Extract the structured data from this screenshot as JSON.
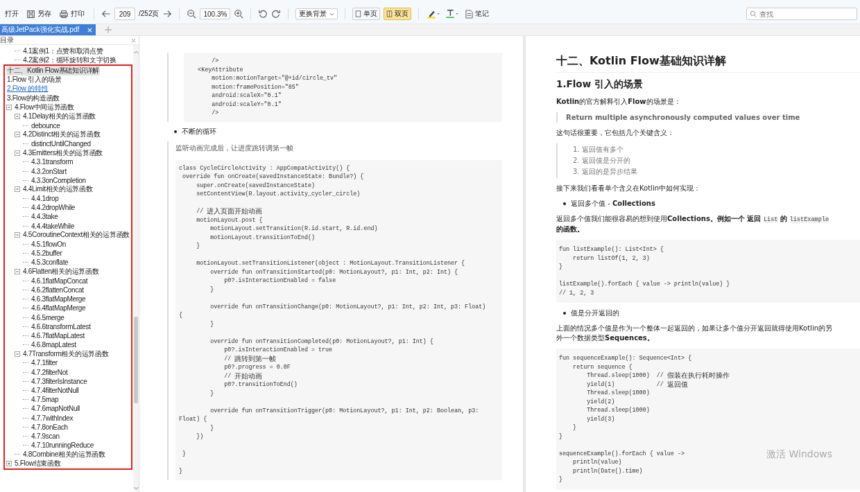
{
  "toolbar": {
    "items": [
      {
        "kind": "open",
        "label": "打开"
      },
      {
        "kind": "save",
        "label": "另存"
      },
      {
        "kind": "print",
        "label": "打印"
      },
      {
        "kind": "sep"
      },
      {
        "kind": "prev"
      },
      {
        "kind": "page",
        "value": "209",
        "total": "/252页"
      },
      {
        "kind": "next"
      },
      {
        "kind": "sep"
      },
      {
        "kind": "zoom_out"
      },
      {
        "kind": "zoom",
        "value": "100.3%"
      },
      {
        "kind": "zoom_in"
      },
      {
        "kind": "sep"
      },
      {
        "kind": "rotate_left"
      },
      {
        "kind": "rotate_right"
      },
      {
        "kind": "sep"
      },
      {
        "kind": "background",
        "label": "更换背景"
      },
      {
        "kind": "sep"
      },
      {
        "kind": "view",
        "label": "单页",
        "selected": false
      },
      {
        "kind": "view",
        "label": "双页",
        "selected": true
      },
      {
        "kind": "sep"
      },
      {
        "kind": "highlight"
      },
      {
        "kind": "text_color"
      },
      {
        "kind": "note",
        "label": "笔记"
      }
    ],
    "search": {
      "placeholder": "查找"
    }
  },
  "tabs": [
    {
      "label": "高级JetPack强化实战.pdf",
      "selected": true
    }
  ],
  "sidebar": {
    "title": "目录",
    "toc_above": [
      {
        "label": "4.1案例1：点赞和取消点赞",
        "selected": false,
        "hovered": false
      },
      {
        "label": "4.2案例2：循环旋转和文字切换",
        "selected": false,
        "hovered": false
      }
    ],
    "toc": [
      {
        "label": "十二、Kotlin Flow基础知识详解",
        "selected": true,
        "hovered": false
      },
      {
        "label": "1.Flow 引入的场景",
        "selected": false,
        "hovered": false
      },
      {
        "label": "2.Flow 的特性",
        "selected": false,
        "hovered": true
      },
      {
        "label": "3.Flow的构造函数",
        "selected": false,
        "hovered": false
      },
      {
        "label": "4.Flow中间运算函数",
        "selected": false,
        "hovered": false,
        "expanded": true,
        "children": [
          {
            "label": "4.1Delay相关的运算函数",
            "selected": false,
            "hovered": false,
            "expanded": true,
            "children": [
              {
                "label": "debounce",
                "selected": false,
                "hovered": false
              }
            ]
          },
          {
            "label": "4.2Distinct相关的运算函数",
            "selected": false,
            "hovered": false,
            "expanded": true,
            "children": [
              {
                "label": "distinctUntilChanged",
                "selected": false,
                "hovered": false
              }
            ]
          },
          {
            "label": "4.3Emitters相关的运算函数",
            "selected": false,
            "hovered": false,
            "expanded": true,
            "children": [
              {
                "label": "4.3.1transform",
                "selected": false,
                "hovered": false
              },
              {
                "label": "4.3.2onStart",
                "selected": false,
                "hovered": false
              },
              {
                "label": "4.3.3onCompletion",
                "selected": false,
                "hovered": false
              }
            ]
          },
          {
            "label": "4.4Limit相关的运算函数",
            "selected": false,
            "hovered": false,
            "expanded": true,
            "children": [
              {
                "label": "4.4.1drop",
                "selected": false,
                "hovered": false
              },
              {
                "label": "4.4.2dropWhile",
                "selected": false,
                "hovered": false
              },
              {
                "label": "4.4.3take",
                "selected": false,
                "hovered": false
              },
              {
                "label": "4.4.4takeWhile",
                "selected": false,
                "hovered": false
              }
            ]
          },
          {
            "label": "4.5CoroutineContext相关的运算函数",
            "selected": false,
            "hovered": false,
            "expanded": true,
            "children": [
              {
                "label": "4.5.1flowOn",
                "selected": false,
                "hovered": false
              },
              {
                "label": "4.5.2buffer",
                "selected": false,
                "hovered": false
              },
              {
                "label": "4.5.3conflate",
                "selected": false,
                "hovered": false
              }
            ]
          },
          {
            "label": "4.6Flatten相关的运算函数",
            "selected": false,
            "hovered": false,
            "expanded": true,
            "children": [
              {
                "label": "4.6.1flatMapConcat",
                "selected": false,
                "hovered": false
              },
              {
                "label": "4.6.2flattenConcat",
                "selected": false,
                "hovered": false
              },
              {
                "label": "4.6.3flatMapMerge",
                "selected": false,
                "hovered": false
              },
              {
                "label": "4.6.4flatMapMerge",
                "selected": false,
                "hovered": false
              },
              {
                "label": "4.6.5merge",
                "selected": false,
                "hovered": false
              },
              {
                "label": "4.6.6transformLatest",
                "selected": false,
                "hovered": false
              },
              {
                "label": "4.6.7flatMapLatest",
                "selected": false,
                "hovered": false
              },
              {
                "label": "4.6.8mapLatest",
                "selected": false,
                "hovered": false
              }
            ]
          },
          {
            "label": "4.7Transform相关的运算函数",
            "selected": false,
            "hovered": false,
            "expanded": true,
            "children": [
              {
                "label": "4.7.1filter",
                "selected": false,
                "hovered": false
              },
              {
                "label": "4.7.2filterNot",
                "selected": false,
                "hovered": false
              },
              {
                "label": "4.7.3filterIsInstance",
                "selected": false,
                "hovered": false
              },
              {
                "label": "4.7.4filterNotNull",
                "selected": false,
                "hovered": false
              },
              {
                "label": "4.7.5map",
                "selected": false,
                "hovered": false
              },
              {
                "label": "4.7.6mapNotNull",
                "selected": false,
                "hovered": false
              },
              {
                "label": "4.7.7withIndex",
                "selected": false,
                "hovered": false
              },
              {
                "label": "4.7.8onEach",
                "selected": false,
                "hovered": false
              },
              {
                "label": "4.7.9scan",
                "selected": false,
                "hovered": false
              },
              {
                "label": "4.7.10runningReduce",
                "selected": false,
                "hovered": false
              }
            ]
          },
          {
            "label": "4.8Combine相关的运算函数",
            "selected": false,
            "hovered": false
          }
        ]
      },
      {
        "label": "5.Flow结束函数",
        "selected": false,
        "hovered": false,
        "expanded": false
      }
    ]
  },
  "pages": [
    {
      "blocks": [
        {
          "kind": "code",
          "code": "        />\n    <KeyAttribute\n        motion:motionTarget=\"@+id/circle_tv\"\n        motion:framePosition=\"85\"\n        android:scaleX=\"0.1\"\n        android:scaleY=\"0.1\"\n        />"
        },
        {
          "kind": "bullet",
          "text": "不断的循环"
        },
        {
          "kind": "quote",
          "text": "监听动画完成后，让进度跳转调第一帧"
        },
        {
          "kind": "code",
          "code": "class CycleCircleActivity : AppCompatActivity() {\n override fun onCreate(savedInstanceState: Bundle?) {\n     super.onCreate(savedInstanceState)\n     setContentView(R.layout.activity_cycler_circle)\n\n     // 进入页面开始动画\n     motionLayout.post {\n         motionLayout.setTransition(R.id.start, R.id.end)\n         motionLayout.transitionToEnd()\n     }\n\n     motionLayout.setTransitionListener(object : MotionLayout.TransitionListener {\n         override fun onTransitionStarted(p0: MotionLayout?, p1: Int, p2: Int) {\n             p0?.isInteractionEnabled = false\n         }\n\n         override fun onTransitionChange(p0: MotionLayout?, p1: Int, p2: Int, p3: Float)\n{\n         }\n\n         override fun onTransitionCompleted(p0: MotionLayout?, p1: Int) {\n             p0?.isInteractionEnabled = true\n             // 跳转到第一帧\n             p0?.progress = 0.0F\n             // 开始动画\n             p0?.transitionToEnd()\n         }\n\n         override fun onTransitionTrigger(p0: MotionLayout?, p1: Int, p2: Boolean, p3:\nFloat) {\n         }\n     })\n\n }\n\n}"
        }
      ]
    },
    {
      "blocks": [
        {
          "kind": "h1",
          "text": "十二、Kotlin Flow基础知识详解"
        },
        {
          "kind": "h2",
          "text": "1.Flow 引入的场景"
        },
        {
          "kind": "p",
          "runs": [
            {
              "kind": "text",
              "text": "**Kotlin**的官方解释引入**Flow**的场景是："
            }
          ]
        },
        {
          "kind": "quote_strong",
          "text": "Return multiple asynchronously computed values over time"
        },
        {
          "kind": "p",
          "runs": [
            {
              "kind": "text",
              "text": "这句话很重要，它包括几个关键含义："
            }
          ]
        },
        {
          "kind": "list_quote",
          "items": [
            "1. 返回值有多个",
            "2. 返回值是分开的",
            "3. 返回的是异步结果"
          ]
        },
        {
          "kind": "p",
          "runs": [
            {
              "kind": "text",
              "text": "接下来我们看看单个含义在Kotlin中如何实现："
            }
          ]
        },
        {
          "kind": "bullet",
          "text": "返回多个值 - **Collections**"
        },
        {
          "kind": "p",
          "runs": [
            {
              "kind": "text",
              "text": "返回多个值我们能很容易的想到使用"
            },
            {
              "kind": "bold",
              "text": "Collections。例如一个 返回 "
            },
            {
              "kind": "code",
              "text": "List"
            },
            {
              "kind": "bold",
              "text": " 的 "
            },
            {
              "kind": "code",
              "text": "listExample"
            },
            {
              "kind": "bold",
              "text": " 的函数。"
            }
          ]
        },
        {
          "kind": "code",
          "code": "fun listExample(): List<Int> {\n    return listOf(1, 2, 3)\n}\n\nlistExample().forEach { value -> println(value) }\n// 1, 2, 3"
        },
        {
          "kind": "bullet",
          "text": "值是分开返回的"
        },
        {
          "kind": "p",
          "runs": [
            {
              "kind": "text",
              "text": "上面的情况多个值是作为一个整体一起返回的，如果让多个值分开返回就得使用Kotlin的另外一个数据类型**Sequences。**"
            }
          ]
        },
        {
          "kind": "code",
          "code": "fun sequenceExample(): Sequence<Int> {\n    return sequence {\n        Thread.sleep(1000)  // 假装在执行耗时操作\n        yield(1)            // 返回值\n        Thread.sleep(1000)\n        yield(2)\n        Thread.sleep(1000)\n        yield(3)\n    }\n}\n\nsequenceExample().forEach { value ->\n    println(value)\n    println(Date().time)\n}"
        }
      ]
    }
  ],
  "os_overlay": {
    "text": "激活 Windows"
  }
}
